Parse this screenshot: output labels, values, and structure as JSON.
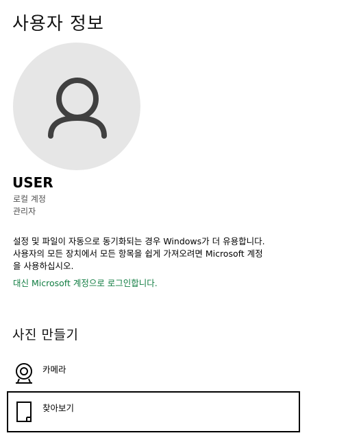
{
  "page": {
    "title": "사용자 정보"
  },
  "user": {
    "name": "USER",
    "account_type": "로컬 계정",
    "role": "관리자"
  },
  "sync": {
    "line1": "설정 및 파일이 자동으로 동기화되는 경우 Windows가 더 유용합니다.",
    "line2": "사용자의 모든 장치에서 모든 항목을 쉽게 가져오려면 Microsoft 계정",
    "line3": "을 사용하십시오.",
    "link": "대신 Microsoft 계정으로 로그인합니다."
  },
  "create_photo": {
    "title": "사진 만들기",
    "options": [
      {
        "label": "카메라",
        "icon": "camera-icon"
      },
      {
        "label": "찾아보기",
        "icon": "browse-icon"
      }
    ]
  },
  "colors": {
    "link": "#107c41",
    "avatar_bg": "#e6e6e6",
    "avatar_glyph": "#404040"
  }
}
